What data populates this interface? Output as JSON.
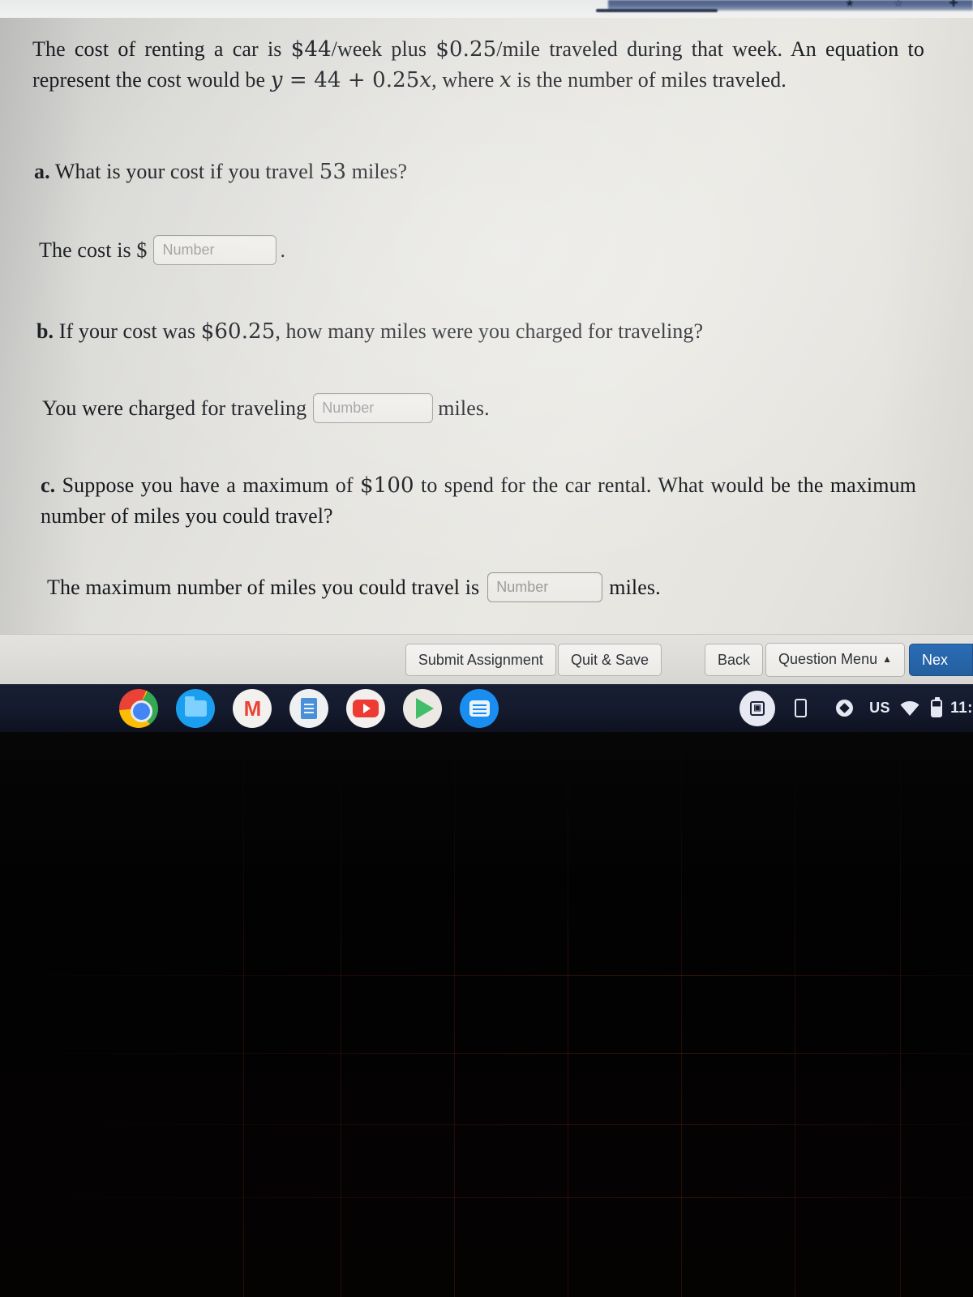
{
  "browser": {
    "bookmark_icon": "star-icon",
    "extensions_icon": "puzzle-piece-icon"
  },
  "question": {
    "intro_part1": "The cost of renting a car is ",
    "intro_money1": "$44",
    "intro_part2": "/week plus ",
    "intro_money2": "$0.25",
    "intro_part3": "/mile traveled during that week. An equation to represent the cost would be ",
    "equation_y": "y",
    "equation_eq": " = ",
    "equation_rhs": "44 + 0.25",
    "equation_x": "x",
    "intro_part4": ", where ",
    "intro_x2": "x",
    "intro_part5": " is the number of miles traveled.",
    "parts": [
      {
        "label": "a.",
        "prompt_pre": " What is your cost if you travel ",
        "prompt_num": "53",
        "prompt_post": " miles?",
        "answer_pre": "The cost is $",
        "answer_post": ".",
        "input_placeholder": "Number"
      },
      {
        "label": "b.",
        "prompt_pre": " If your cost was ",
        "prompt_num": "$60.25",
        "prompt_post": ", how many miles were you charged for traveling?",
        "answer_pre": "You were charged for traveling",
        "answer_post": "miles.",
        "input_placeholder": "Number"
      },
      {
        "label": "c.",
        "prompt_pre": " Suppose you have a maximum of ",
        "prompt_num": "$100",
        "prompt_post": " to spend for the car rental. What would be the maximum number of miles you could travel?",
        "answer_pre": "The maximum number of miles you could travel is",
        "answer_post": "miles.",
        "input_placeholder": "Number"
      }
    ]
  },
  "toolbar": {
    "submit_label": "Submit Assignment",
    "quit_label": "Quit & Save",
    "back_label": "Back",
    "question_menu_label": "Question Menu",
    "question_menu_caret": "▲",
    "next_label": "Nex",
    "primary_color": "#2a6cb5"
  },
  "shelf": {
    "apps": [
      {
        "name": "chrome-app-icon",
        "label": "Chrome",
        "running": true
      },
      {
        "name": "files-app-icon",
        "label": "Files",
        "running": false
      },
      {
        "name": "gmail-app-icon",
        "label": "Gmail",
        "glyph": "M",
        "running": false
      },
      {
        "name": "docs-app-icon",
        "label": "Docs",
        "running": false
      },
      {
        "name": "youtube-app-icon",
        "label": "YouTube",
        "running": false
      },
      {
        "name": "play-store-app-icon",
        "label": "Play Store",
        "running": false
      },
      {
        "name": "messages-app-icon",
        "label": "Messages",
        "running": false
      }
    ],
    "tray": {
      "capture_icon": "screen-capture-icon",
      "phone_icon": "phone-hub-icon",
      "circle_icon": "status-circle-icon",
      "keyboard_layout": "US",
      "wifi_icon": "wifi-icon",
      "battery_icon": "battery-icon",
      "time": "11:"
    }
  }
}
